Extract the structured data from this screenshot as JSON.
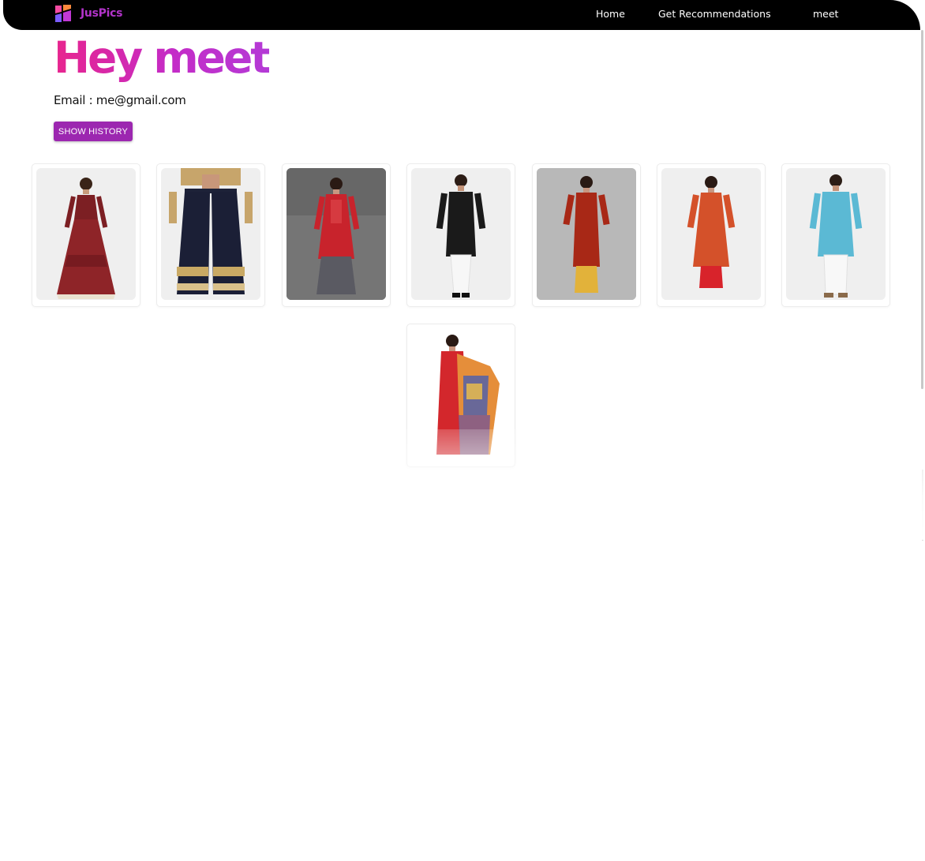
{
  "navbar": {
    "brand": "JusPics",
    "links": {
      "home": "Home",
      "recommend": "Get Recommendations",
      "user": "meet"
    }
  },
  "profile": {
    "greeting": "Hey meet",
    "email": "Email : me@gmail.com",
    "history_button": "SHOW HISTORY"
  },
  "products": [
    {
      "icon": "maroon-anarkali-dress-photo"
    },
    {
      "icon": "navy-gold-sharara-pants-photo"
    },
    {
      "icon": "red-kurta-grey-palazzo-photo"
    },
    {
      "icon": "black-kurta-white-pyjama-photo"
    },
    {
      "icon": "rust-kurta-yellow-pants-photo"
    },
    {
      "icon": "orange-kurta-red-pants-photo"
    },
    {
      "icon": "turquoise-kurta-white-pyjama-photo"
    },
    {
      "icon": "red-kurta-printed-dupatta-photo"
    }
  ],
  "colors": {
    "navbar_bg": "#000000",
    "brand": "#b233c9",
    "button": "#9c27b0",
    "greeting_start": "#e8258e",
    "greeting_end": "#b43ad6"
  }
}
